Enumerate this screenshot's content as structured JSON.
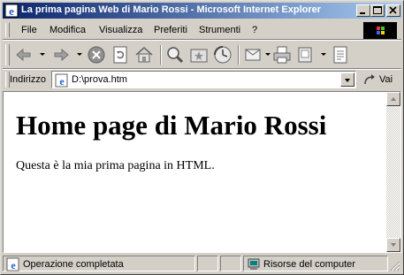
{
  "window": {
    "title": "La prima pagina Web di Mario Rossi - Microsoft Internet Explorer"
  },
  "menubar": {
    "items": [
      {
        "label": "File"
      },
      {
        "label": "Modifica"
      },
      {
        "label": "Visualizza"
      },
      {
        "label": "Preferiti"
      },
      {
        "label": "Strumenti"
      },
      {
        "label": "?"
      }
    ]
  },
  "toolbar": {
    "buttons": [
      "back-icon",
      "forward-icon",
      "stop-icon",
      "refresh-icon",
      "home-icon",
      "search-icon",
      "favorites-icon",
      "history-icon",
      "mail-icon",
      "print-icon",
      "edit-icon",
      "discuss-icon"
    ]
  },
  "address": {
    "label": "Indirizzo",
    "value": "D:\\prova.htm",
    "go_label": "Vai"
  },
  "page": {
    "heading": "Home page di Mario Rossi",
    "paragraph": "Questa è la mia prima pagina in HTML."
  },
  "status": {
    "text": "Operazione completata",
    "zone": "Risorse del computer"
  },
  "colors": {
    "titlebar_start": "#0a246a",
    "titlebar_end": "#a6caf0",
    "chrome": "#d4d0c8"
  }
}
